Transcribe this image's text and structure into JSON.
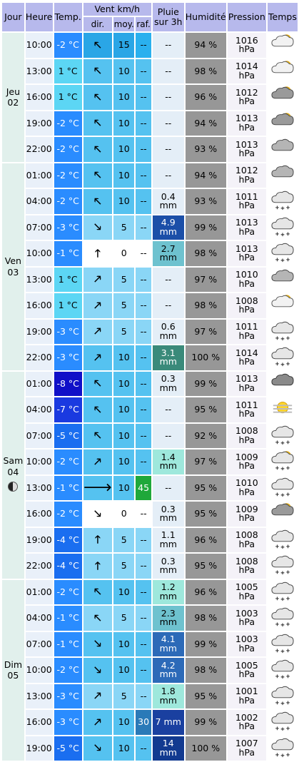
{
  "header": {
    "jour": "Jour",
    "heure": "Heure",
    "temp": "Temp.",
    "vent": "Vent km/h",
    "pluie": "Pluie sur 3h",
    "humidite": "Humidité",
    "pression": "Pression",
    "temps": "Temps",
    "dir": "dir.",
    "moy": "moy.",
    "raf": "raf."
  },
  "colors": {
    "header_bg": "#b7b9ec",
    "day_bg": "#e1f0ec",
    "hour_bg": "#e9f0f9",
    "hum_bg": "#979797",
    "pres_bg": "#f4f2f8"
  },
  "rows": [
    {
      "day": "Jeu",
      "date": "02",
      "moon": false,
      "span": 5,
      "heure": "10:00",
      "temp": "-2 °C",
      "tc": "#2a8cff",
      "tw": true,
      "dir": "nw",
      "moy": "15",
      "mc": "#2aa6e6",
      "raf": "--",
      "rc": "#2ab0ee",
      "pluie": "--",
      "pc": "#e4eef7",
      "hum": "94 %",
      "pres": "1016 hPa",
      "icon": "sun-cloud"
    },
    {
      "heure": "13:00",
      "temp": "1 °C",
      "tc": "#5cd6f4",
      "tw": false,
      "dir": "nw",
      "moy": "10",
      "mc": "#55c2f0",
      "raf": "--",
      "rc": "#55c2f0",
      "pluie": "--",
      "pc": "#e4eef7",
      "hum": "98 %",
      "pres": "1014 hPa",
      "icon": "sun-cloud"
    },
    {
      "heure": "16:00",
      "temp": "1 °C",
      "tc": "#5cd6f4",
      "tw": false,
      "dir": "nw",
      "moy": "10",
      "mc": "#55c2f0",
      "raf": "--",
      "rc": "#55c2f0",
      "pluie": "--",
      "pc": "#e4eef7",
      "hum": "96 %",
      "pres": "1012 hPa",
      "icon": "sun-cloud-dark"
    },
    {
      "heure": "19:00",
      "temp": "-2 °C",
      "tc": "#2a8cff",
      "tw": true,
      "dir": "nw",
      "moy": "10",
      "mc": "#55c2f0",
      "raf": "--",
      "rc": "#55c2f0",
      "pluie": "--",
      "pc": "#e4eef7",
      "hum": "94 %",
      "pres": "1013 hPa",
      "icon": "sun-cloud-dark"
    },
    {
      "heure": "22:00",
      "temp": "-2 °C",
      "tc": "#2a8cff",
      "tw": true,
      "dir": "nw",
      "moy": "10",
      "mc": "#55c2f0",
      "raf": "--",
      "rc": "#55c2f0",
      "pluie": "--",
      "pc": "#e4eef7",
      "hum": "93 %",
      "pres": "1013 hPa",
      "icon": "cloud"
    },
    {
      "day": "Ven",
      "date": "03",
      "moon": false,
      "span": 8,
      "heure": "01:00",
      "temp": "-2 °C",
      "tc": "#2a8cff",
      "tw": true,
      "dir": "nw",
      "moy": "10",
      "mc": "#55c2f0",
      "raf": "--",
      "rc": "#55c2f0",
      "pluie": "--",
      "pc": "#e4eef7",
      "hum": "94 %",
      "pres": "1012 hPa",
      "icon": "cloud"
    },
    {
      "heure": "04:00",
      "temp": "-2 °C",
      "tc": "#2a8cff",
      "tw": true,
      "dir": "nw",
      "moy": "10",
      "mc": "#55c2f0",
      "raf": "--",
      "rc": "#55c2f0",
      "pluie": "0.4 mm",
      "pc": "#e4eef7",
      "hum": "93 %",
      "pres": "1011 hPa",
      "icon": "snow"
    },
    {
      "heure": "07:00",
      "temp": "-3 °C",
      "tc": "#2a8cff",
      "tw": true,
      "dir": "se",
      "moy": "5",
      "mc": "#8ad6f6",
      "raf": "--",
      "rc": "#8ad6f6",
      "pluie": "4.9 mm",
      "pc": "#1b4fa8",
      "pw": true,
      "hum": "99 %",
      "pres": "1013 hPa",
      "icon": "snow"
    },
    {
      "heure": "10:00",
      "temp": "-1 °C",
      "tc": "#2a8cff",
      "tw": true,
      "dir": "n",
      "moy": "0",
      "mc": "#ffffff",
      "raf": "--",
      "rc": "#ffffff",
      "pluie": "2.7 mm",
      "pc": "#6ec2cf",
      "hum": "98 %",
      "pres": "1013 hPa",
      "icon": "snow"
    },
    {
      "heure": "13:00",
      "temp": "1 °C",
      "tc": "#5cd6f4",
      "tw": false,
      "dir": "ne",
      "moy": "5",
      "mc": "#8ad6f6",
      "raf": "--",
      "rc": "#8ad6f6",
      "pluie": "--",
      "pc": "#e4eef7",
      "hum": "97 %",
      "pres": "1010 hPa",
      "icon": "cloud"
    },
    {
      "heure": "16:00",
      "temp": "1 °C",
      "tc": "#5cd6f4",
      "tw": false,
      "dir": "ne",
      "moy": "5",
      "mc": "#8ad6f6",
      "raf": "--",
      "rc": "#8ad6f6",
      "pluie": "--",
      "pc": "#e4eef7",
      "hum": "98 %",
      "pres": "1008 hPa",
      "icon": "sun-cloud"
    },
    {
      "heure": "19:00",
      "temp": "-3 °C",
      "tc": "#2a8cff",
      "tw": true,
      "dir": "ne",
      "moy": "5",
      "mc": "#8ad6f6",
      "raf": "--",
      "rc": "#8ad6f6",
      "pluie": "0.6 mm",
      "pc": "#e4eef7",
      "hum": "97 %",
      "pres": "1011 hPa",
      "icon": "snow"
    },
    {
      "heure": "22:00",
      "temp": "-3 °C",
      "tc": "#2a8cff",
      "tw": true,
      "dir": "ne",
      "moy": "10",
      "mc": "#55c2f0",
      "raf": "--",
      "rc": "#55c2f0",
      "pluie": "3.1 mm",
      "pc": "#3a8a7a",
      "pw": true,
      "hum": "100 %",
      "pres": "1014 hPa",
      "icon": "snow"
    },
    {
      "day": "Sam",
      "date": "04",
      "moon": true,
      "span": 8,
      "heure": "01:00",
      "temp": "-8 °C",
      "tc": "#1010c8",
      "tw": true,
      "dir": "nw",
      "moy": "10",
      "mc": "#55c2f0",
      "raf": "--",
      "rc": "#55c2f0",
      "pluie": "0.3 mm",
      "pc": "#e4eef7",
      "hum": "99 %",
      "pres": "1013 hPa",
      "icon": "cloud-dark"
    },
    {
      "heure": "04:00",
      "temp": "-7 °C",
      "tc": "#1a3ae0",
      "tw": true,
      "dir": "nw",
      "moy": "10",
      "mc": "#55c2f0",
      "raf": "--",
      "rc": "#55c2f0",
      "pluie": "--",
      "pc": "#e4eef7",
      "hum": "95 %",
      "pres": "1011 hPa",
      "icon": "haze-sun"
    },
    {
      "heure": "07:00",
      "temp": "-5 °C",
      "tc": "#1a6ef0",
      "tw": true,
      "dir": "nw",
      "moy": "10",
      "mc": "#55c2f0",
      "raf": "--",
      "rc": "#55c2f0",
      "pluie": "--",
      "pc": "#e4eef7",
      "hum": "92 %",
      "pres": "1008 hPa",
      "icon": "snow"
    },
    {
      "heure": "10:00",
      "temp": "-2 °C",
      "tc": "#2a8cff",
      "tw": true,
      "dir": "ne",
      "moy": "10",
      "mc": "#55c2f0",
      "raf": "--",
      "rc": "#55c2f0",
      "pluie": "1.4 mm",
      "pc": "#9ee8dc",
      "hum": "97 %",
      "pres": "1009 hPa",
      "icon": "snow-sun"
    },
    {
      "heure": "13:00",
      "temp": "-1 °C",
      "tc": "#2a8cff",
      "tw": true,
      "dir": "e",
      "moy": "10",
      "mc": "#55c2f0",
      "raf": "45",
      "rc": "#1fa83a",
      "rw": true,
      "pluie": "--",
      "pc": "#e4eef7",
      "hum": "95 %",
      "pres": "1010 hPa",
      "icon": "snow"
    },
    {
      "heure": "16:00",
      "temp": "-2 °C",
      "tc": "#2a8cff",
      "tw": true,
      "dir": "se",
      "moy": "0",
      "mc": "#ffffff",
      "raf": "--",
      "rc": "#ffffff",
      "pluie": "0.3 mm",
      "pc": "#e4eef7",
      "hum": "95 %",
      "pres": "1009 hPa",
      "icon": "sun-cloud-dark"
    },
    {
      "heure": "19:00",
      "temp": "-4 °C",
      "tc": "#1a6ef0",
      "tw": true,
      "dir": "n",
      "moy": "5",
      "mc": "#8ad6f6",
      "raf": "--",
      "rc": "#8ad6f6",
      "pluie": "1.1 mm",
      "pc": "#e4eef7",
      "hum": "96 %",
      "pres": "1008 hPa",
      "icon": "snow"
    },
    {
      "heure": "22:00",
      "temp": "-4 °C",
      "tc": "#1a6ef0",
      "tw": true,
      "dir": "n",
      "moy": "5",
      "mc": "#8ad6f6",
      "raf": "--",
      "rc": "#8ad6f6",
      "pluie": "0.3 mm",
      "pc": "#e4eef7",
      "hum": "95 %",
      "pres": "1008 hPa",
      "icon": "snow"
    },
    {
      "day": "Dim",
      "date": "05",
      "moon": false,
      "span": 7,
      "heure": "01:00",
      "temp": "-2 °C",
      "tc": "#2a8cff",
      "tw": true,
      "dir": "nw",
      "moy": "10",
      "mc": "#55c2f0",
      "raf": "--",
      "rc": "#55c2f0",
      "pluie": "1.2 mm",
      "pc": "#9ee8dc",
      "hum": "96 %",
      "pres": "1005 hPa",
      "icon": "snow"
    },
    {
      "heure": "04:00",
      "temp": "-1 °C",
      "tc": "#2a8cff",
      "tw": true,
      "dir": "nw",
      "moy": "5",
      "mc": "#8ad6f6",
      "raf": "--",
      "rc": "#8ad6f6",
      "pluie": "2.3 mm",
      "pc": "#6ec2cf",
      "hum": "98 %",
      "pres": "1003 hPa",
      "icon": "snow"
    },
    {
      "heure": "07:00",
      "temp": "-1 °C",
      "tc": "#2a8cff",
      "tw": true,
      "dir": "se",
      "moy": "10",
      "mc": "#55c2f0",
      "raf": "--",
      "rc": "#55c2f0",
      "pluie": "4.1 mm",
      "pc": "#2c6ab8",
      "pw": true,
      "hum": "99 %",
      "pres": "1003 hPa",
      "icon": "snow"
    },
    {
      "heure": "10:00",
      "temp": "-2 °C",
      "tc": "#2a8cff",
      "tw": true,
      "dir": "se",
      "moy": "10",
      "mc": "#55c2f0",
      "raf": "--",
      "rc": "#55c2f0",
      "pluie": "4.2 mm",
      "pc": "#2c6ab8",
      "pw": true,
      "hum": "98 %",
      "pres": "1005 hPa",
      "icon": "snow"
    },
    {
      "heure": "13:00",
      "temp": "-3 °C",
      "tc": "#2a8cff",
      "tw": true,
      "dir": "ne",
      "moy": "5",
      "mc": "#8ad6f6",
      "raf": "--",
      "rc": "#8ad6f6",
      "pluie": "1.8 mm",
      "pc": "#9ee8dc",
      "hum": "95 %",
      "pres": "1001 hPa",
      "icon": "snow"
    },
    {
      "heure": "16:00",
      "temp": "-3 °C",
      "tc": "#2a8cff",
      "tw": true,
      "dir": "ne",
      "moy": "10",
      "mc": "#55c2f0",
      "raf": "30",
      "rc": "#2a7ab8",
      "rw": true,
      "pluie": "7 mm",
      "pc": "#1a40a0",
      "pw": true,
      "hum": "99 %",
      "pres": "1002 hPa",
      "icon": "snow"
    },
    {
      "heure": "19:00",
      "temp": "-5 °C",
      "tc": "#1a6ef0",
      "tw": true,
      "dir": "se",
      "moy": "10",
      "mc": "#55c2f0",
      "raf": "--",
      "rc": "#55c2f0",
      "pluie": "14 mm",
      "pc": "#123a90",
      "pw": true,
      "hum": "100 %",
      "pres": "1007 hPa",
      "icon": "snow"
    }
  ]
}
